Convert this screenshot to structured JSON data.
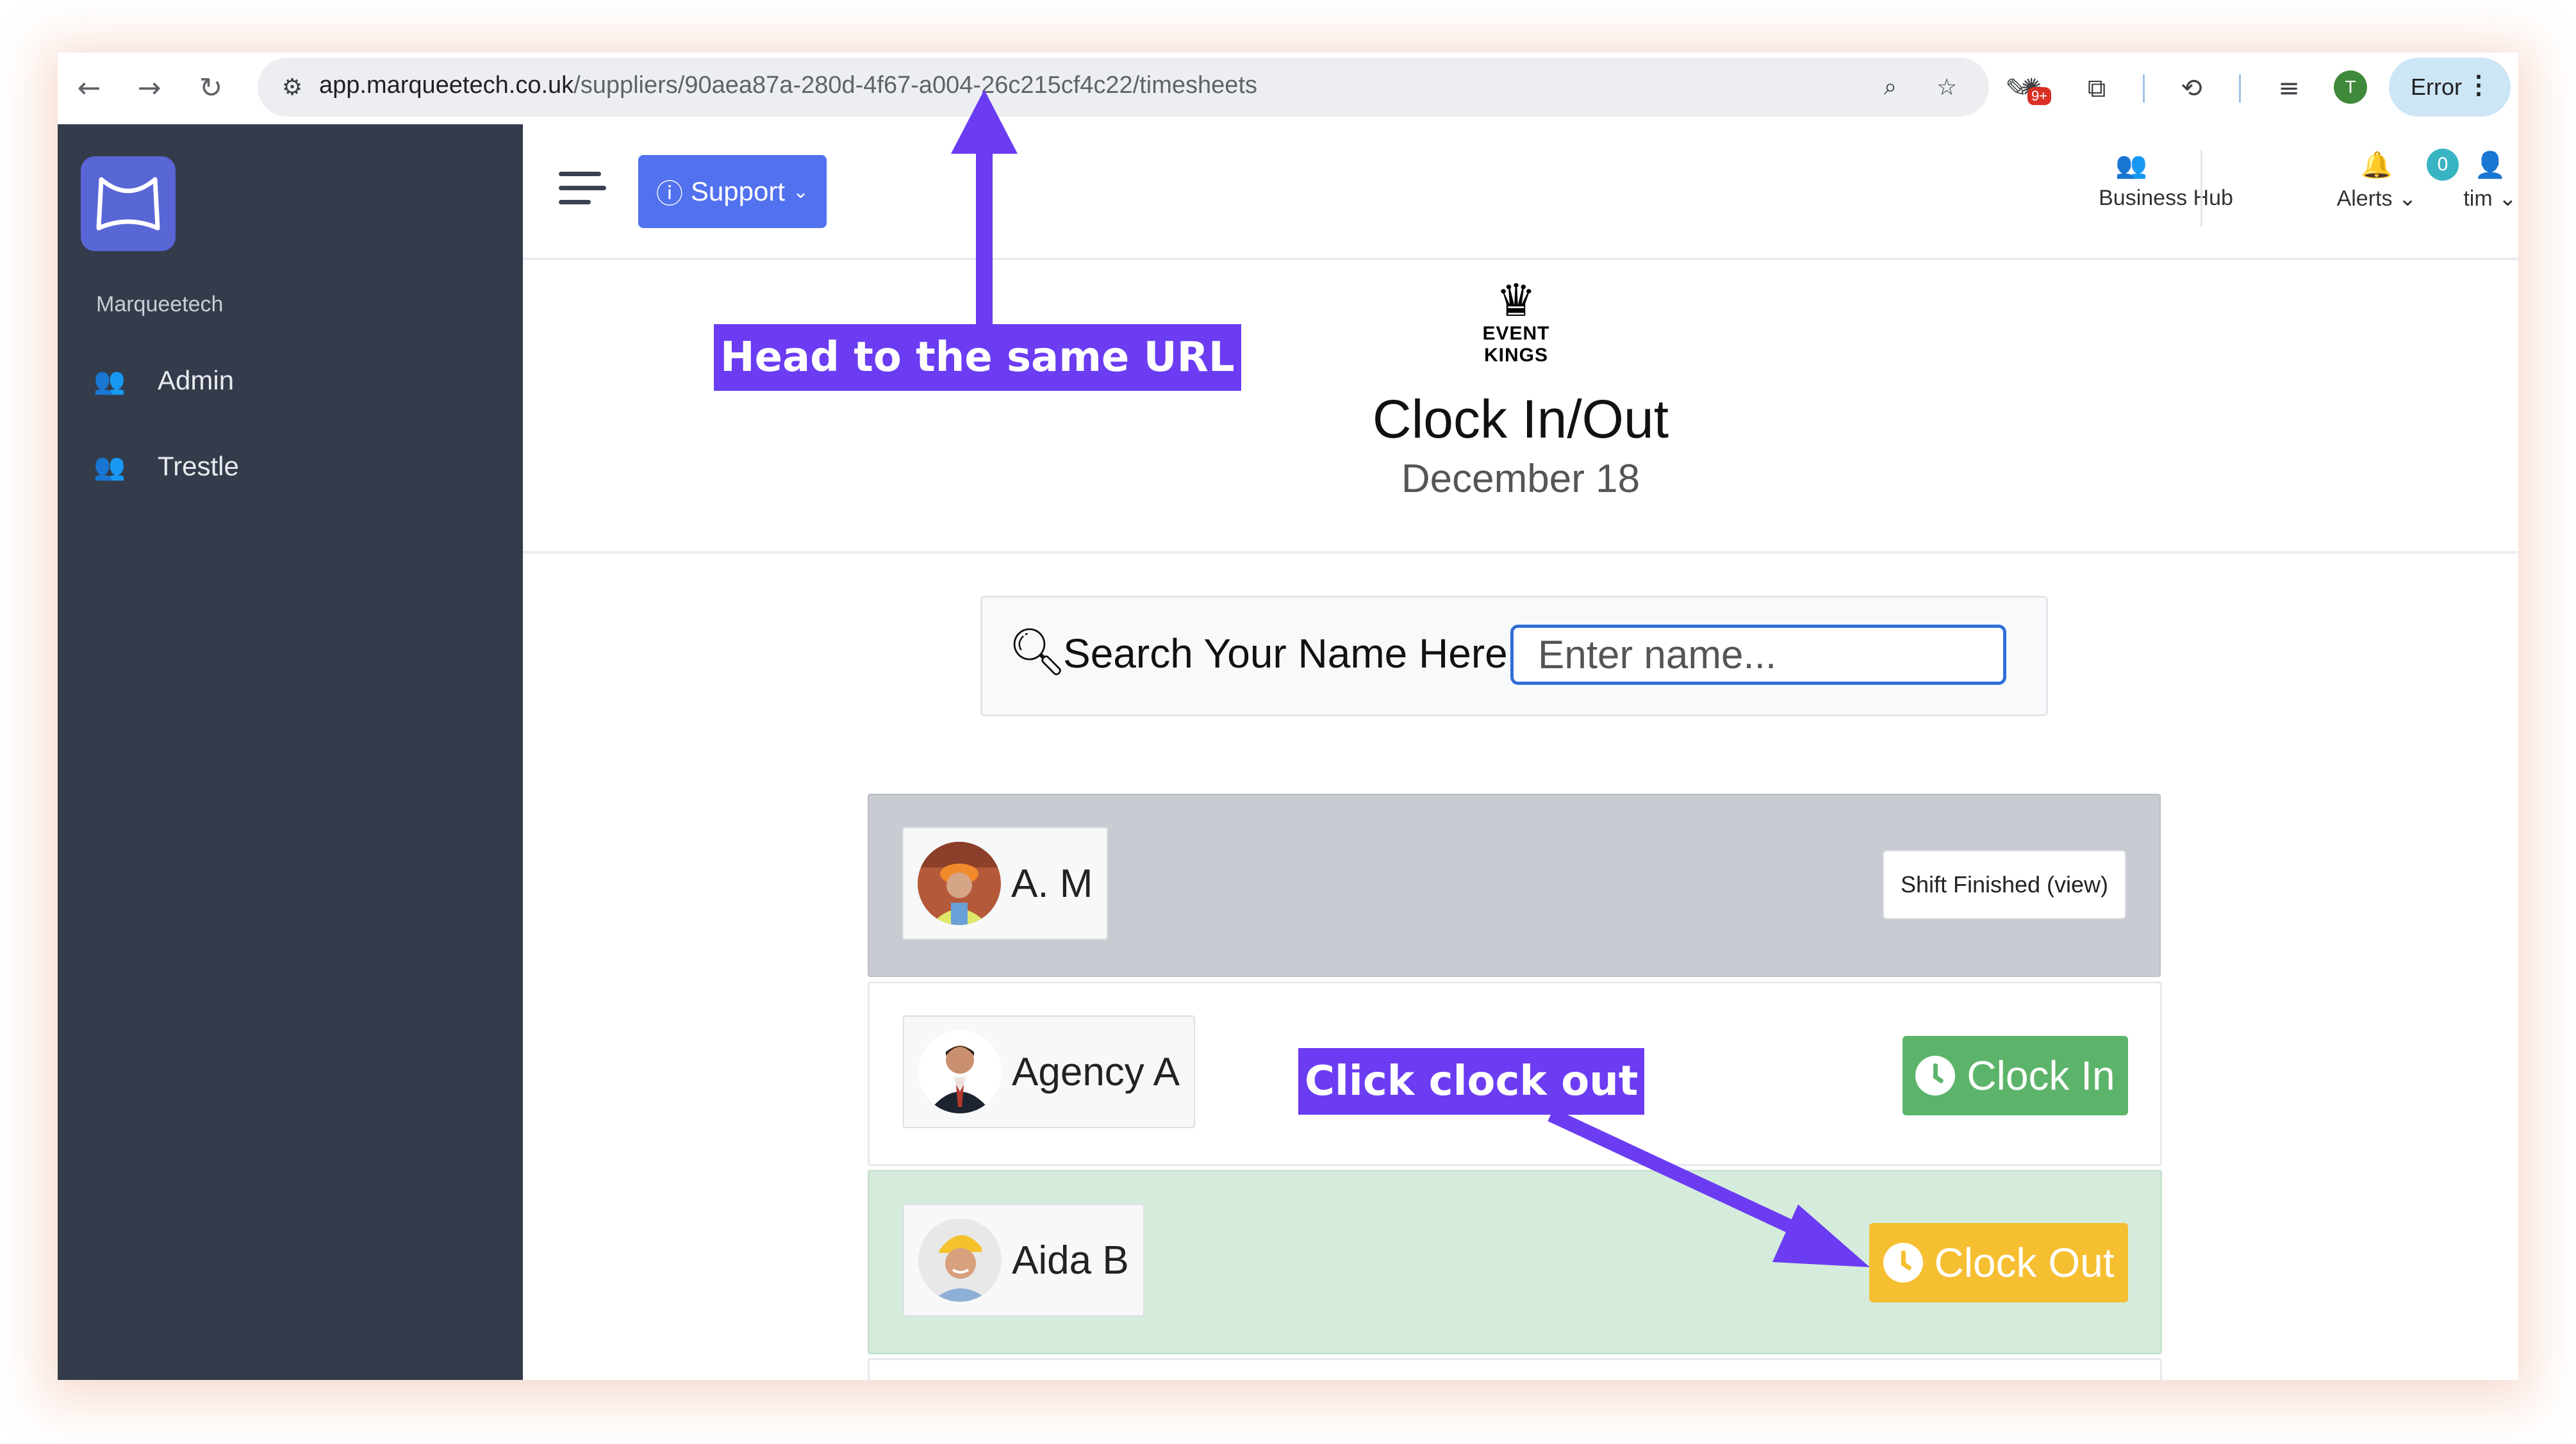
{
  "browser": {
    "url_host": "app.marqueetech.co.uk",
    "url_path": "/suppliers/90aea87a-280d-4f67-a004-26c215cf4c22/timesheets",
    "extension_badge": "9+",
    "profile_initial": "T",
    "error_label": "Error",
    "icons": [
      "back-icon",
      "forward-icon",
      "reload-icon",
      "site-settings-icon",
      "zoom-icon",
      "star-icon",
      "pen-icon",
      "extension-icon",
      "puzzle-icon",
      "history-icon",
      "reading-list-icon",
      "menu-dots-icon"
    ]
  },
  "sidebar": {
    "org_name": "Marqueetech",
    "items": [
      {
        "label": "Admin",
        "icon": "users-gear-icon"
      },
      {
        "label": "Trestle",
        "icon": "users-gear-icon"
      }
    ]
  },
  "topbar": {
    "support_label": "Support",
    "business_hub_label": "Business Hub",
    "alerts_label": "Alerts",
    "alerts_count": "0",
    "user_label": "tim"
  },
  "header": {
    "brand_line1": "EVENT",
    "brand_line2": "KINGS",
    "title": "Clock In/Out",
    "date": "December 18"
  },
  "search": {
    "label": "Search Your Name Here:",
    "placeholder": "Enter name..."
  },
  "rows": [
    {
      "name": "A. M",
      "action": "Shift Finished (view)",
      "state": "finished"
    },
    {
      "name": "Agency A",
      "action": "Clock In",
      "state": "not-started"
    },
    {
      "name": "Aida B",
      "action": "Clock Out",
      "state": "active"
    }
  ],
  "annotations": {
    "url_callout": "Head to the same URL",
    "button_callout": "Click clock out"
  },
  "colors": {
    "accent": "#6b3cf2",
    "sidebar": "#343c4b",
    "support": "#5271ef",
    "clock_in": "#5cb46a",
    "clock_out": "#f6bf32"
  }
}
